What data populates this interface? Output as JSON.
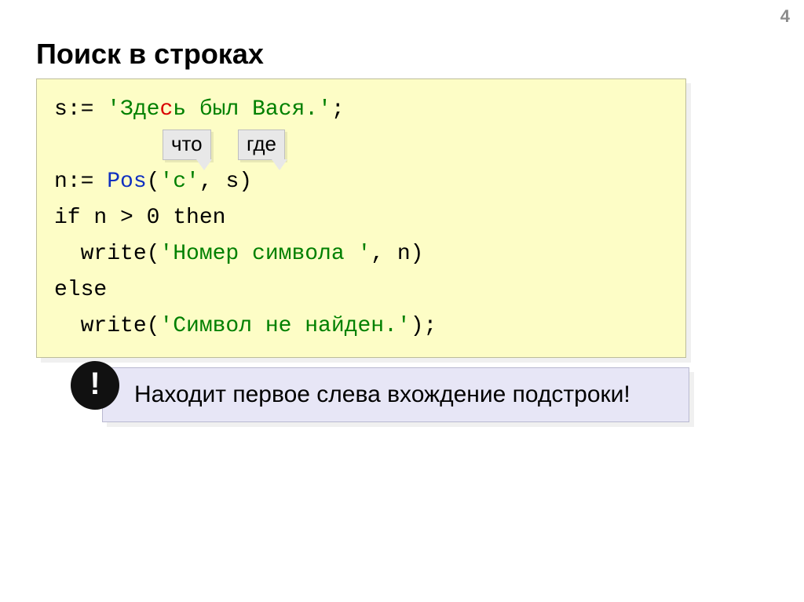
{
  "page_number": "4",
  "title": "Поиск в строках",
  "code": {
    "l1_a": "s:= ",
    "l1_q1": "'",
    "l1_b": "Зде",
    "l1_hl": "с",
    "l1_c": "ь был Вася.",
    "l1_q2": "'",
    "l1_semi": ";",
    "l2_blank": " ",
    "l3_a": "n:= ",
    "l3_fn": "Pos",
    "l3_b": "(",
    "l3_c": "'с'",
    "l3_d": ", s)",
    "l4": "if n > 0 then",
    "l5_a": "  write(",
    "l5_b": "'Номер символа '",
    "l5_c": ", n)",
    "l6": "else",
    "l7_a": "  write(",
    "l7_b": "'Символ не найден.'",
    "l7_c": ");"
  },
  "tooltips": {
    "what": "что",
    "where": "где"
  },
  "note": "Находит первое слева вхождение подстроки!",
  "excl": "!"
}
